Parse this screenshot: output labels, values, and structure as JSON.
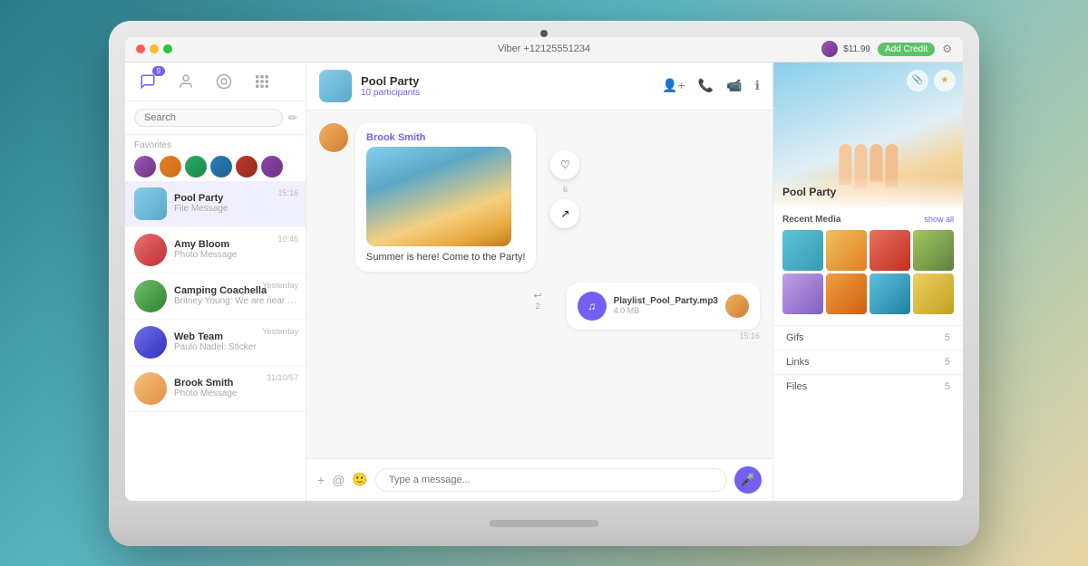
{
  "titlebar": {
    "phone": "Viber +12125551234",
    "credit": "$11.99",
    "add_credit": "Add Credit"
  },
  "sidebar": {
    "badge": "9",
    "search_placeholder": "Search",
    "favorites_label": "Favorites",
    "favorites": [
      {
        "color": "#9b59b6"
      },
      {
        "color": "#e67e22"
      },
      {
        "color": "#27ae60"
      },
      {
        "color": "#2980b9"
      },
      {
        "color": "#c0392b"
      },
      {
        "color": "#8e44ad"
      }
    ],
    "chats": [
      {
        "name": "Pool Party",
        "preview": "File Message",
        "time": "15:16",
        "active": true
      },
      {
        "name": "Amy Bloom",
        "preview": "Photo Message",
        "time": "10:45",
        "active": false
      },
      {
        "name": "Camping Coachella",
        "preview": "Britney Young: We are near the entrance! Come get the ticket.",
        "time": "Yesterday",
        "active": false
      },
      {
        "name": "Web Team",
        "preview": "Paulo Nadel: Sticker",
        "time": "Yesterday",
        "active": false
      },
      {
        "name": "Brook Smith",
        "preview": "Photo Message",
        "time": "31/10/57",
        "active": false
      }
    ]
  },
  "chat": {
    "name": "Pool Party",
    "participants": "10 participants",
    "messages": [
      {
        "id": "msg1",
        "type": "image_text",
        "sender": "Brook Smith",
        "text": "Summer is here! Come to the Party!",
        "likes": "6",
        "time": ""
      },
      {
        "id": "msg2",
        "type": "file",
        "filename": "Playlist_Pool_Party.mp3",
        "filesize": "4.0 MB",
        "time": "15:16",
        "replies": "2"
      }
    ],
    "input_placeholder": "Type a message..."
  },
  "right_panel": {
    "group_name": "Pool Party",
    "recent_media_label": "Recent Media",
    "show_all": "show all",
    "stats": [
      {
        "label": "Gifs",
        "value": "5"
      },
      {
        "label": "Links",
        "value": "5"
      },
      {
        "label": "Files",
        "value": "5"
      }
    ]
  }
}
